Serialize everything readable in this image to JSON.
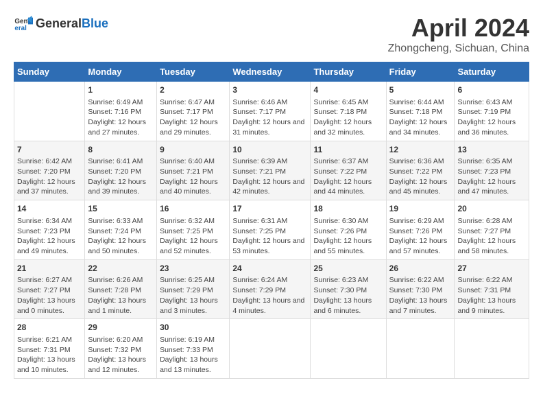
{
  "header": {
    "logo_general": "General",
    "logo_blue": "Blue",
    "title": "April 2024",
    "subtitle": "Zhongcheng, Sichuan, China"
  },
  "columns": [
    "Sunday",
    "Monday",
    "Tuesday",
    "Wednesday",
    "Thursday",
    "Friday",
    "Saturday"
  ],
  "weeks": [
    [
      {
        "day": "",
        "sunrise": "",
        "sunset": "",
        "daylight": ""
      },
      {
        "day": "1",
        "sunrise": "6:49 AM",
        "sunset": "7:16 PM",
        "daylight": "12 hours and 27 minutes."
      },
      {
        "day": "2",
        "sunrise": "6:47 AM",
        "sunset": "7:17 PM",
        "daylight": "12 hours and 29 minutes."
      },
      {
        "day": "3",
        "sunrise": "6:46 AM",
        "sunset": "7:17 PM",
        "daylight": "12 hours and 31 minutes."
      },
      {
        "day": "4",
        "sunrise": "6:45 AM",
        "sunset": "7:18 PM",
        "daylight": "12 hours and 32 minutes."
      },
      {
        "day": "5",
        "sunrise": "6:44 AM",
        "sunset": "7:18 PM",
        "daylight": "12 hours and 34 minutes."
      },
      {
        "day": "6",
        "sunrise": "6:43 AM",
        "sunset": "7:19 PM",
        "daylight": "12 hours and 36 minutes."
      }
    ],
    [
      {
        "day": "7",
        "sunrise": "6:42 AM",
        "sunset": "7:20 PM",
        "daylight": "12 hours and 37 minutes."
      },
      {
        "day": "8",
        "sunrise": "6:41 AM",
        "sunset": "7:20 PM",
        "daylight": "12 hours and 39 minutes."
      },
      {
        "day": "9",
        "sunrise": "6:40 AM",
        "sunset": "7:21 PM",
        "daylight": "12 hours and 40 minutes."
      },
      {
        "day": "10",
        "sunrise": "6:39 AM",
        "sunset": "7:21 PM",
        "daylight": "12 hours and 42 minutes."
      },
      {
        "day": "11",
        "sunrise": "6:37 AM",
        "sunset": "7:22 PM",
        "daylight": "12 hours and 44 minutes."
      },
      {
        "day": "12",
        "sunrise": "6:36 AM",
        "sunset": "7:22 PM",
        "daylight": "12 hours and 45 minutes."
      },
      {
        "day": "13",
        "sunrise": "6:35 AM",
        "sunset": "7:23 PM",
        "daylight": "12 hours and 47 minutes."
      }
    ],
    [
      {
        "day": "14",
        "sunrise": "6:34 AM",
        "sunset": "7:23 PM",
        "daylight": "12 hours and 49 minutes."
      },
      {
        "day": "15",
        "sunrise": "6:33 AM",
        "sunset": "7:24 PM",
        "daylight": "12 hours and 50 minutes."
      },
      {
        "day": "16",
        "sunrise": "6:32 AM",
        "sunset": "7:25 PM",
        "daylight": "12 hours and 52 minutes."
      },
      {
        "day": "17",
        "sunrise": "6:31 AM",
        "sunset": "7:25 PM",
        "daylight": "12 hours and 53 minutes."
      },
      {
        "day": "18",
        "sunrise": "6:30 AM",
        "sunset": "7:26 PM",
        "daylight": "12 hours and 55 minutes."
      },
      {
        "day": "19",
        "sunrise": "6:29 AM",
        "sunset": "7:26 PM",
        "daylight": "12 hours and 57 minutes."
      },
      {
        "day": "20",
        "sunrise": "6:28 AM",
        "sunset": "7:27 PM",
        "daylight": "12 hours and 58 minutes."
      }
    ],
    [
      {
        "day": "21",
        "sunrise": "6:27 AM",
        "sunset": "7:27 PM",
        "daylight": "13 hours and 0 minutes."
      },
      {
        "day": "22",
        "sunrise": "6:26 AM",
        "sunset": "7:28 PM",
        "daylight": "13 hours and 1 minute."
      },
      {
        "day": "23",
        "sunrise": "6:25 AM",
        "sunset": "7:29 PM",
        "daylight": "13 hours and 3 minutes."
      },
      {
        "day": "24",
        "sunrise": "6:24 AM",
        "sunset": "7:29 PM",
        "daylight": "13 hours and 4 minutes."
      },
      {
        "day": "25",
        "sunrise": "6:23 AM",
        "sunset": "7:30 PM",
        "daylight": "13 hours and 6 minutes."
      },
      {
        "day": "26",
        "sunrise": "6:22 AM",
        "sunset": "7:30 PM",
        "daylight": "13 hours and 7 minutes."
      },
      {
        "day": "27",
        "sunrise": "6:22 AM",
        "sunset": "7:31 PM",
        "daylight": "13 hours and 9 minutes."
      }
    ],
    [
      {
        "day": "28",
        "sunrise": "6:21 AM",
        "sunset": "7:31 PM",
        "daylight": "13 hours and 10 minutes."
      },
      {
        "day": "29",
        "sunrise": "6:20 AM",
        "sunset": "7:32 PM",
        "daylight": "13 hours and 12 minutes."
      },
      {
        "day": "30",
        "sunrise": "6:19 AM",
        "sunset": "7:33 PM",
        "daylight": "13 hours and 13 minutes."
      },
      {
        "day": "",
        "sunrise": "",
        "sunset": "",
        "daylight": ""
      },
      {
        "day": "",
        "sunrise": "",
        "sunset": "",
        "daylight": ""
      },
      {
        "day": "",
        "sunrise": "",
        "sunset": "",
        "daylight": ""
      },
      {
        "day": "",
        "sunrise": "",
        "sunset": "",
        "daylight": ""
      }
    ]
  ],
  "labels": {
    "sunrise_prefix": "Sunrise: ",
    "sunset_prefix": "Sunset: ",
    "daylight_prefix": "Daylight: "
  }
}
